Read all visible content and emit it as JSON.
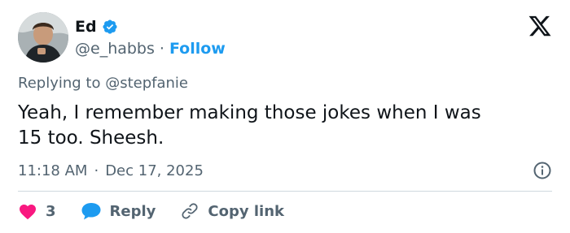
{
  "user": {
    "display_name": "Ed",
    "handle": "@e_habbs",
    "separator": "·",
    "follow_label": "Follow"
  },
  "tweet": {
    "reply_prefix": "Replying to @stepfanie",
    "text": "Yeah, I remember making those jokes when I was\n15 too. Sheesh.",
    "time": "11:18 AM",
    "date_separator": "·",
    "date": "Dec 17, 2025"
  },
  "actions": {
    "like_count": "3",
    "reply_label": "Reply",
    "copy_link_label": "Copy link"
  },
  "colors": {
    "accent": "#1d9bf0",
    "like": "#f91880",
    "text": "#0f1419",
    "secondary": "#536471",
    "divider": "#cfd9de"
  },
  "icons": {
    "verified": "verified-badge-icon",
    "logo": "x-logo-icon",
    "info": "info-icon",
    "like": "heart-icon",
    "reply": "speech-bubble-icon",
    "copy": "link-icon"
  }
}
